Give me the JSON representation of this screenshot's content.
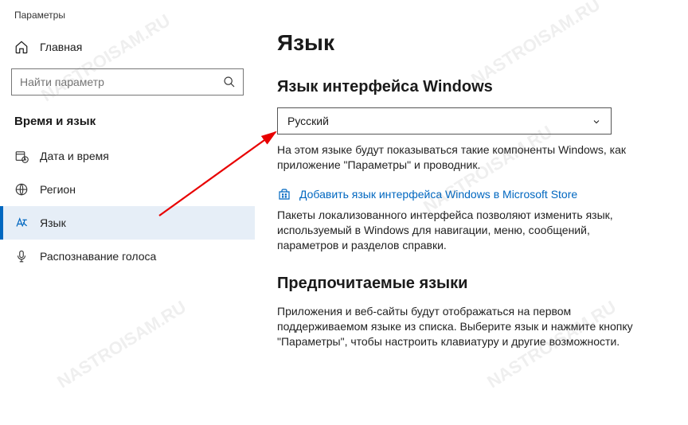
{
  "app_title": "Параметры",
  "home_label": "Главная",
  "search_placeholder": "Найти параметр",
  "section_title": "Время и язык",
  "nav": {
    "datetime": "Дата и время",
    "region": "Регион",
    "language": "Язык",
    "speech": "Распознавание голоса"
  },
  "page_title": "Язык",
  "display_lang_heading": "Язык интерфейса Windows",
  "dropdown_selected": "Русский",
  "display_lang_desc": "На этом языке будут показываться такие компоненты Windows, как приложение \"Параметры\" и проводник.",
  "store_link": "Добавить язык интерфейса Windows в Microsoft Store",
  "packs_desc": "Пакеты локализованного интерфейса позволяют изменить язык, используемый в Windows для навигации, меню, сообщений, параметров и разделов справки.",
  "preferred_heading": "Предпочитаемые языки",
  "preferred_desc": "Приложения и веб-сайты будут отображаться на первом поддерживаемом языке из списка. Выберите язык и нажмите кнопку \"Параметры\", чтобы настроить клавиатуру и другие возможности.",
  "watermark": "NASTROISAM.RU"
}
